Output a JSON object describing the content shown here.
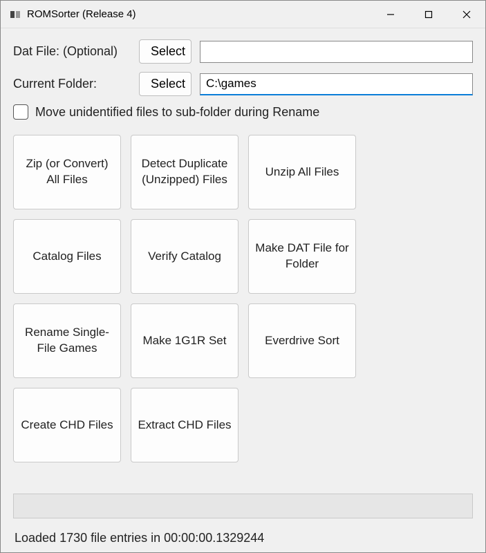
{
  "window": {
    "title": "ROMSorter (Release 4)"
  },
  "form": {
    "dat_file_label": "Dat File: (Optional)",
    "dat_file_select_btn": "Select",
    "dat_file_value": "",
    "current_folder_label": "Current Folder:",
    "current_folder_select_btn": "Select",
    "current_folder_value": "C:\\games",
    "move_unidentified_label": "Move unidentified files to sub-folder during Rename",
    "move_unidentified_checked": false
  },
  "actions": [
    "Zip (or Convert) All Files",
    "Detect Duplicate (Unzipped) Files",
    "Unzip All Files",
    "Catalog Files",
    "Verify Catalog",
    "Make DAT File for Folder",
    "Rename Single-File Games",
    "Make 1G1R Set",
    "Everdrive Sort",
    "Create CHD Files",
    "Extract CHD Files"
  ],
  "status": "Loaded 1730 file entries in 00:00:00.1329244"
}
